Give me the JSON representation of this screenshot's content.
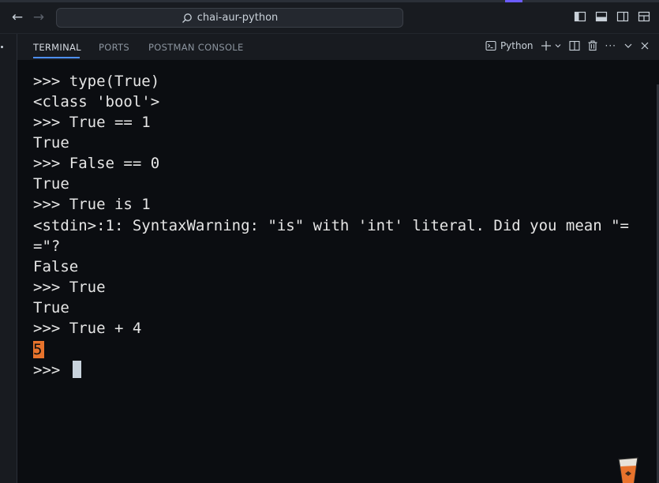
{
  "titlebar": {
    "search_text": "chai-aur-python",
    "back_icon": "arrow-left-icon",
    "forward_icon": "arrow-right-icon",
    "layout_icons": [
      "toggle-primary-sidebar-icon",
      "toggle-panel-icon",
      "toggle-secondary-sidebar-icon",
      "customize-layout-icon"
    ]
  },
  "panel": {
    "tabs": [
      {
        "label": "TERMINAL",
        "active": true
      },
      {
        "label": "PORTS",
        "active": false
      },
      {
        "label": "POSTMAN CONSOLE",
        "active": false
      }
    ],
    "terminal_profile": "Python"
  },
  "terminal": {
    "lines": [
      ">>> type(True)",
      "<class 'bool'>",
      ">>> True == 1",
      "True",
      ">>> False == 0",
      "True",
      ">>> True is 1",
      "<stdin>:1: SyntaxWarning: \"is\" with 'int' literal. Did you mean \"=",
      "=\"?",
      "False",
      ">>> True",
      "True",
      ">>> True + 4"
    ],
    "highlighted_result": "5",
    "prompt": ">>> "
  },
  "colors": {
    "accent": "#4d90fe",
    "highlight": "#e8732c",
    "background": "#0b0d11"
  }
}
